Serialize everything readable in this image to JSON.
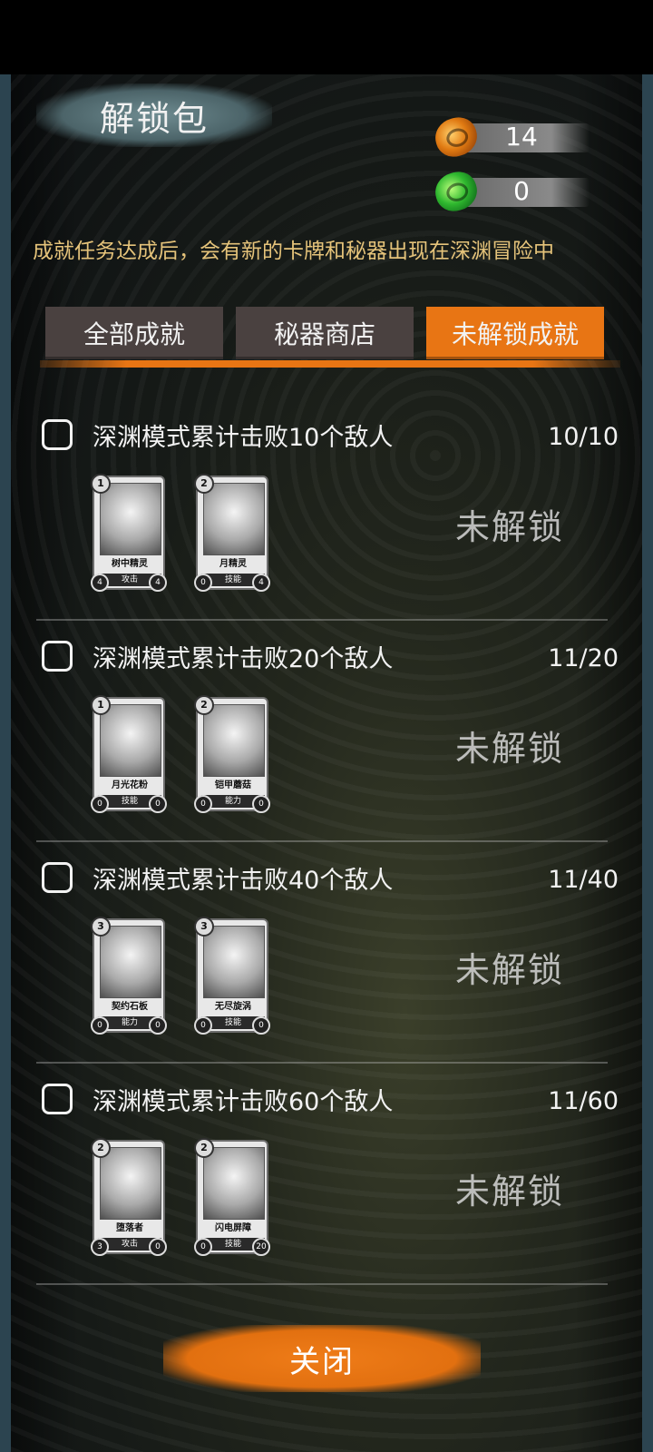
{
  "title": "解锁包",
  "currencies": [
    {
      "icon": "orange-gem-icon",
      "value": "14",
      "color": "#e07a12"
    },
    {
      "icon": "green-gem-icon",
      "value": "0",
      "color": "#2fb82f"
    }
  ],
  "description": "成就任务达成后，会有新的卡牌和秘器出现在深渊冒险中",
  "tabs": [
    {
      "label": "全部成就"
    },
    {
      "label": "秘器商店"
    },
    {
      "label": "未解锁成就",
      "active": true
    }
  ],
  "achievements": [
    {
      "task": "深渊模式累计击败10个敌人",
      "progress": "10/10",
      "status": "未解锁",
      "cards": [
        {
          "cost": "1",
          "name": "树中精灵",
          "type": "攻击",
          "left_stat": "4",
          "right_stat": "4"
        },
        {
          "cost": "2",
          "name": "月精灵",
          "type": "技能",
          "left_stat": "0",
          "right_stat": "4"
        }
      ]
    },
    {
      "task": "深渊模式累计击败20个敌人",
      "progress": "11/20",
      "status": "未解锁",
      "cards": [
        {
          "cost": "1",
          "name": "月光花粉",
          "type": "技能",
          "left_stat": "0",
          "right_stat": "0"
        },
        {
          "cost": "2",
          "name": "铠甲蘑菇",
          "type": "能力",
          "left_stat": "0",
          "right_stat": "0"
        }
      ]
    },
    {
      "task": "深渊模式累计击败40个敌人",
      "progress": "11/40",
      "status": "未解锁",
      "cards": [
        {
          "cost": "3",
          "name": "契约石板",
          "type": "能力",
          "left_stat": "0",
          "right_stat": "0"
        },
        {
          "cost": "3",
          "name": "无尽旋涡",
          "type": "技能",
          "left_stat": "0",
          "right_stat": "0"
        }
      ]
    },
    {
      "task": "深渊模式累计击败60个敌人",
      "progress": "11/60",
      "status": "未解锁",
      "cards": [
        {
          "cost": "2",
          "name": "堕落者",
          "type": "攻击",
          "left_stat": "3",
          "right_stat": "0"
        },
        {
          "cost": "2",
          "name": "闪电屏障",
          "type": "技能",
          "left_stat": "0",
          "right_stat": "20"
        }
      ]
    }
  ],
  "close_label": "关闭"
}
